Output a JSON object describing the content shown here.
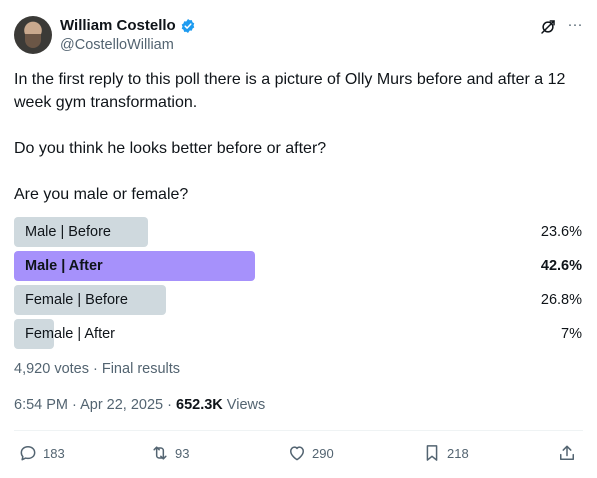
{
  "author": {
    "display_name": "William Costello",
    "handle": "@CostelloWilliam"
  },
  "tweet": {
    "paragraphs": [
      "In the first reply to this poll there is a picture of Olly Murs before and after a 12 week gym transformation.",
      "Do you think he looks better before or after?",
      "Are you male or female?"
    ]
  },
  "poll": {
    "options": [
      {
        "label": "Male | Before",
        "percent": "23.6%",
        "value": 23.6,
        "winner": false
      },
      {
        "label": "Male | After",
        "percent": "42.6%",
        "value": 42.6,
        "winner": true
      },
      {
        "label": "Female | Before",
        "percent": "26.8%",
        "value": 26.8,
        "winner": false
      },
      {
        "label": "Female | After",
        "percent": "7%",
        "value": 7,
        "winner": false
      }
    ],
    "summary": "4,920 votes · Final results"
  },
  "meta": {
    "time": "6:54 PM · Apr 22, 2025 · ",
    "views_count": "652.3K",
    "views_label": " Views"
  },
  "actions": {
    "replies": "183",
    "reposts": "93",
    "likes": "290",
    "bookmarks": "218"
  },
  "colors": {
    "winner_bar": "#a691fb",
    "bar": "#cfd9de",
    "verified": "#1d9bf0",
    "secondary_text": "#536471"
  }
}
